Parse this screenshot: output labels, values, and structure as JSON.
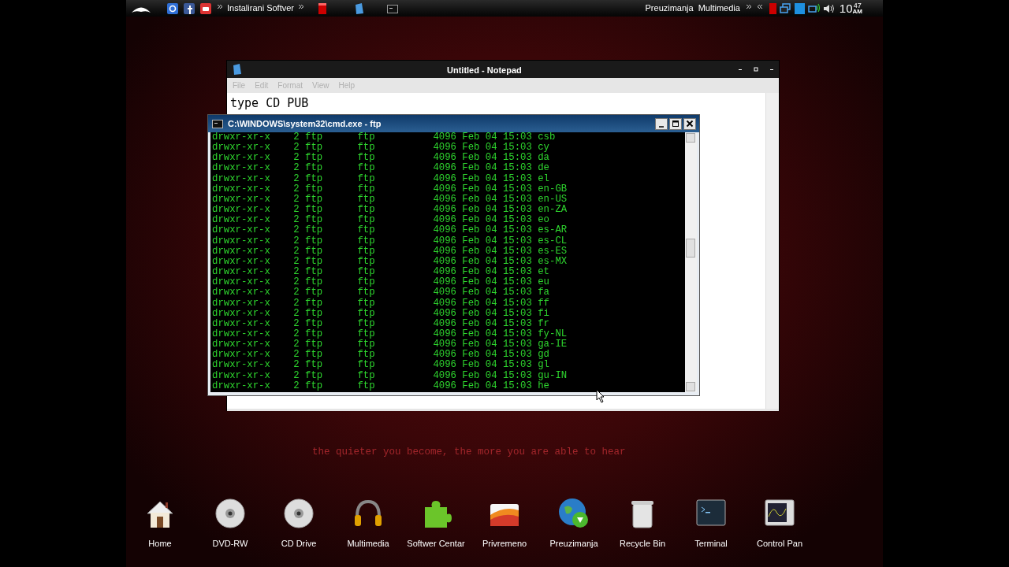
{
  "top_panel": {
    "launcher_label": "Instalirani Softver",
    "right_labels": [
      "Preuzimanja",
      "Multimedia"
    ],
    "clock": {
      "hour": "10",
      "minute": "47",
      "period": "AM"
    }
  },
  "notepad": {
    "title": "Untitled - Notepad",
    "menu": [
      {
        "label": "File",
        "disabled": true
      },
      {
        "label": "Edit",
        "disabled": true
      },
      {
        "label": "Format",
        "disabled": true
      },
      {
        "label": "View",
        "disabled": true
      },
      {
        "label": "Help",
        "disabled": true
      }
    ],
    "text": "type CD PUB"
  },
  "console": {
    "title": "C:\\WINDOWS\\system32\\cmd.exe - ftp",
    "lines": [
      "drwxr-xr-x    2 ftp      ftp          4096 Feb 04 15:03 csb",
      "drwxr-xr-x    2 ftp      ftp          4096 Feb 04 15:03 cy",
      "drwxr-xr-x    2 ftp      ftp          4096 Feb 04 15:03 da",
      "drwxr-xr-x    2 ftp      ftp          4096 Feb 04 15:03 de",
      "drwxr-xr-x    2 ftp      ftp          4096 Feb 04 15:03 el",
      "drwxr-xr-x    2 ftp      ftp          4096 Feb 04 15:03 en-GB",
      "drwxr-xr-x    2 ftp      ftp          4096 Feb 04 15:03 en-US",
      "drwxr-xr-x    2 ftp      ftp          4096 Feb 04 15:03 en-ZA",
      "drwxr-xr-x    2 ftp      ftp          4096 Feb 04 15:03 eo",
      "drwxr-xr-x    2 ftp      ftp          4096 Feb 04 15:03 es-AR",
      "drwxr-xr-x    2 ftp      ftp          4096 Feb 04 15:03 es-CL",
      "drwxr-xr-x    2 ftp      ftp          4096 Feb 04 15:03 es-ES",
      "drwxr-xr-x    2 ftp      ftp          4096 Feb 04 15:03 es-MX",
      "drwxr-xr-x    2 ftp      ftp          4096 Feb 04 15:03 et",
      "drwxr-xr-x    2 ftp      ftp          4096 Feb 04 15:03 eu",
      "drwxr-xr-x    2 ftp      ftp          4096 Feb 04 15:03 fa",
      "drwxr-xr-x    2 ftp      ftp          4096 Feb 04 15:03 ff",
      "drwxr-xr-x    2 ftp      ftp          4096 Feb 04 15:03 fi",
      "drwxr-xr-x    2 ftp      ftp          4096 Feb 04 15:03 fr",
      "drwxr-xr-x    2 ftp      ftp          4096 Feb 04 15:03 fy-NL",
      "drwxr-xr-x    2 ftp      ftp          4096 Feb 04 15:03 ga-IE",
      "drwxr-xr-x    2 ftp      ftp          4096 Feb 04 15:03 gd",
      "drwxr-xr-x    2 ftp      ftp          4096 Feb 04 15:03 gl",
      "drwxr-xr-x    2 ftp      ftp          4096 Feb 04 15:03 gu-IN",
      "drwxr-xr-x    2 ftp      ftp          4096 Feb 04 15:03 he"
    ]
  },
  "wallpaper_text": "the quieter you become, the more you are able to hear",
  "dock": [
    {
      "kind": "home",
      "label": "Home"
    },
    {
      "kind": "disc",
      "label": "DVD-RW"
    },
    {
      "kind": "disc",
      "label": "CD Drive"
    },
    {
      "kind": "headphones",
      "label": "Multimedia"
    },
    {
      "kind": "puzzle",
      "label": "Softwer Centar"
    },
    {
      "kind": "folder",
      "label": "Privremeno"
    },
    {
      "kind": "globe",
      "label": "Preuzimanja"
    },
    {
      "kind": "trash",
      "label": "Recycle Bin"
    },
    {
      "kind": "terminal",
      "label": "Terminal"
    },
    {
      "kind": "monitor",
      "label": "Control Pan"
    }
  ]
}
